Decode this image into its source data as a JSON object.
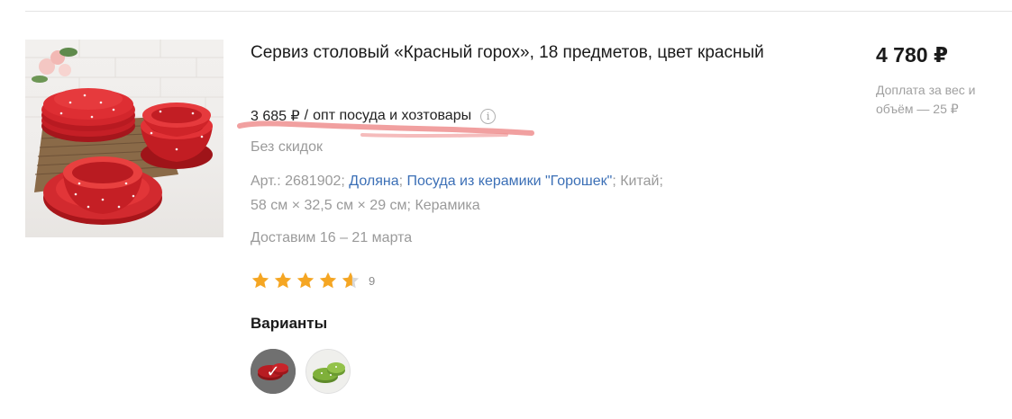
{
  "product": {
    "title": "Сервиз столовый «Красный горох», 18 предметов, цвет красный",
    "wholesale_price": "3 685 ₽",
    "wholesale_sep": "/",
    "wholesale_label": "опт посуда и хозтовары",
    "info_icon": "info-icon",
    "no_discount": "Без скидок",
    "specs": {
      "article_label": "Арт.: 2681902;",
      "brand_link": "Доляна",
      "brand_sep": ";",
      "collection_link": "Посуда из керамики \"Горошек\"",
      "country": "; Китай;",
      "dimensions": "58 см × 32,5 см × 29 см",
      "material": "; Керамика"
    },
    "delivery": "Доставим 16 – 21 марта",
    "rating": {
      "value": 4.6,
      "max": 5,
      "reviews": "9"
    },
    "variants_title": "Варианты",
    "variants": [
      {
        "name": "red",
        "selected": true,
        "check": "✓"
      },
      {
        "name": "green",
        "selected": false
      }
    ],
    "price": "4 780 ₽",
    "surcharge": "Доплата за вес и объём — 25 ₽"
  },
  "colors": {
    "accent_link": "#3b6fb6",
    "star": "#f5a623",
    "underline": "#ef8f8f"
  }
}
